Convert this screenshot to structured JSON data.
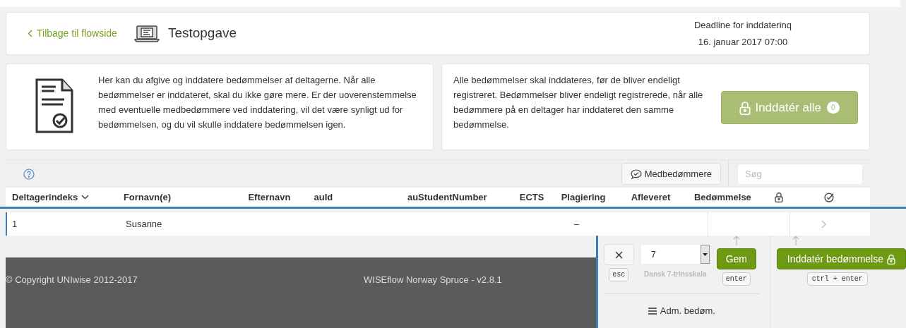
{
  "header": {
    "back_link": "Tilbage til flowside",
    "title": "Testopgave",
    "deadline_label": "Deadline for inddaterinq",
    "deadline_value": "16. januar 2017 07:00"
  },
  "info_left": {
    "text": "Her kan du afgive og inddatere bedømmelser af deltagerne. Når alle bedømmelser er inddateret, skal du ikke gøre mere. Er der uoverenstemmelse med eventuelle medbedømmere ved inddatering, vil det være synligt ud for bedømmelsen, og du vil skulle inddatere bedømmelsen igen."
  },
  "info_right": {
    "text": "Alle bedømmelser skal inddateres, før de bliver endeligt registreret. Bedømmelser bliver endeligt registrerede, når alle bedømmere på en deltager har inddateret den samme bedømmelse.",
    "button": {
      "label": "Inddatér alle",
      "count": "0",
      "disabled": true
    }
  },
  "toolbar": {
    "co_assessors_button": "Medbedømmere",
    "search": {
      "placeholder": "Søg"
    }
  },
  "table": {
    "columns": [
      {
        "label": "Deltagerindeks",
        "kind": "text",
        "sorted": true
      },
      {
        "label": "Fornavn(e)",
        "kind": "text",
        "sorted": false
      },
      {
        "label": "Efternavn",
        "kind": "text",
        "sorted": false
      },
      {
        "label": "auId",
        "kind": "text",
        "sorted": false
      },
      {
        "label": "auStudentNumber",
        "kind": "text",
        "sorted": false
      },
      {
        "label": "ECTS",
        "kind": "text",
        "sorted": false
      },
      {
        "label": "Plagiering",
        "kind": "text",
        "sorted": false
      },
      {
        "label": "Afleveret",
        "kind": "text",
        "sorted": false
      },
      {
        "label": "Bedømmelse",
        "kind": "text",
        "sorted": false
      },
      {
        "kind": "lock"
      },
      {
        "kind": "check"
      }
    ],
    "rows": [
      {
        "index": "1",
        "first_name": "Susanne",
        "plagiarism": "–"
      }
    ]
  },
  "footer": {
    "copyright": "© Copyright UNIwise 2012-2017",
    "version": "WISEflow Norway Spruce - v2.8.1"
  },
  "grading_panel": {
    "cancel_key": "esc",
    "grade": "7",
    "scale": "Dansk 7-trinsskala",
    "save_button": "Gem",
    "save_key": "enter",
    "submit_button": "Inddatér bedømmelse",
    "submit_key": "ctrl + enter",
    "manage_link": "Adm. bedøm."
  }
}
